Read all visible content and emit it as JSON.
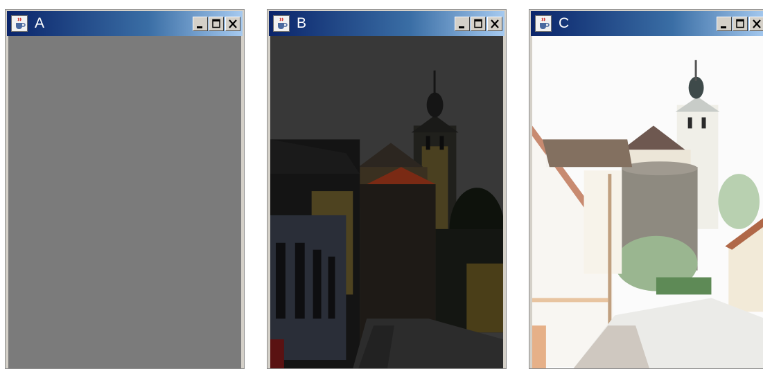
{
  "windows": [
    {
      "title": "A",
      "content": "flat-gray",
      "icons": {
        "app": "java-cup-icon",
        "minimize": "minimize-icon",
        "maximize": "maximize-icon",
        "close": "close-icon"
      }
    },
    {
      "title": "B",
      "content": "darkened-photo",
      "icons": {
        "app": "java-cup-icon",
        "minimize": "minimize-icon",
        "maximize": "maximize-icon",
        "close": "close-icon"
      }
    },
    {
      "title": "C",
      "content": "brightened-photo",
      "icons": {
        "app": "java-cup-icon",
        "minimize": "minimize-icon",
        "maximize": "maximize-icon",
        "close": "close-icon"
      }
    }
  ],
  "colors": {
    "titlebar_start": "#0a246a",
    "titlebar_end": "#a6caf0",
    "chrome": "#d4d0c8",
    "gray_fill": "#7b7b7b"
  }
}
